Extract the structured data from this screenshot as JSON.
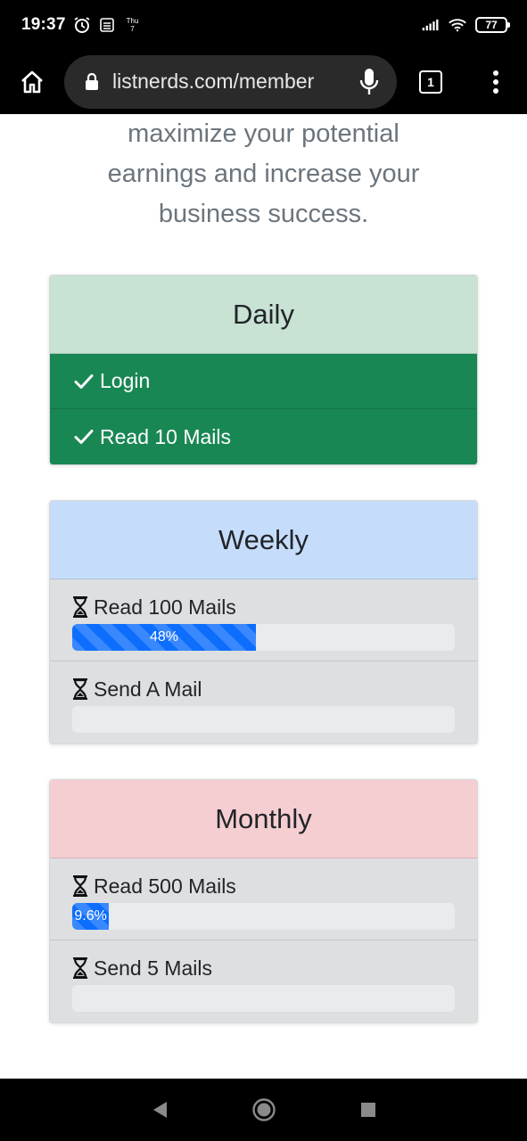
{
  "status_bar": {
    "time": "19:37",
    "day_top": "Thu",
    "day_bottom": "7",
    "battery": "77"
  },
  "browser": {
    "url": "listnerds.com/member",
    "tab_count": "1"
  },
  "intro": {
    "lines": [
      "maximize your potential",
      "earnings and increase your",
      "business success."
    ]
  },
  "cards": {
    "daily": {
      "title": "Daily",
      "items": [
        {
          "label": "Login"
        },
        {
          "label": "Read 10 Mails"
        }
      ]
    },
    "weekly": {
      "title": "Weekly",
      "items": [
        {
          "label": "Read 100 Mails",
          "progress": 48,
          "progress_text": "48%"
        },
        {
          "label": "Send A Mail",
          "progress": 0,
          "progress_text": ""
        }
      ]
    },
    "monthly": {
      "title": "Monthly",
      "items": [
        {
          "label": "Read 500 Mails",
          "progress": 9.6,
          "progress_text": "9.6%"
        },
        {
          "label": "Send 5 Mails",
          "progress": 0,
          "progress_text": ""
        }
      ]
    }
  },
  "colors": {
    "done_green": "#198754",
    "progress_blue": "#0d6efd",
    "daily_header": "#c8e2d3",
    "weekly_header": "#c6dcfb",
    "monthly_header": "#f5ced2"
  },
  "icons": {
    "home": "home-icon",
    "lock": "lock-icon",
    "mic": "microphone-icon",
    "menu": "more-vert-icon",
    "done": "check-icon",
    "pending": "hourglass-icon"
  }
}
